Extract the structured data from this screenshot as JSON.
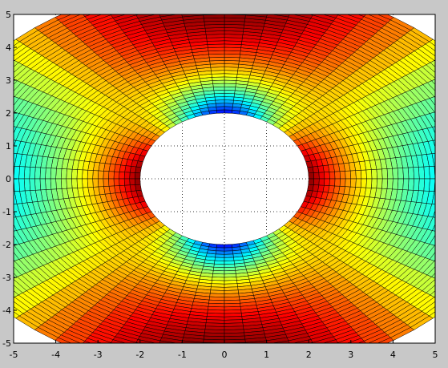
{
  "chart_data": {
    "type": "heatmap",
    "title": "",
    "xlabel": "",
    "ylabel": "",
    "xlim": [
      -5,
      5
    ],
    "ylim": [
      -5,
      5
    ],
    "xticks": [
      -5,
      -4,
      -3,
      -2,
      -1,
      0,
      1,
      2,
      3,
      4,
      5
    ],
    "yticks": [
      5,
      4,
      3,
      2,
      1,
      0,
      -1,
      -2,
      -3,
      -4,
      -5
    ],
    "grid": true,
    "colormap": "jet",
    "domain": {
      "shape": "elliptical annulus",
      "inner_radii": [
        2,
        2
      ],
      "outer_radii": [
        7,
        6
      ],
      "clipped_to_axes": true
    },
    "mesh": {
      "radial_cells": 40,
      "angular_cells": 72
    },
    "value_pattern": {
      "field": "radius-weighted cos(2*theta)",
      "low_near": [
        "inner boundary at top (0, 2)",
        "inner boundary at bottom (0, -2)",
        "outer edge left and right"
      ],
      "high_near": [
        "inner boundary left and right",
        "outer edge top and bottom"
      ]
    },
    "colors": {
      "figure_background": "#c8c8c8",
      "axes_background": "#ffffff",
      "mesh_lines": "#000000",
      "grid": "#000000"
    }
  }
}
